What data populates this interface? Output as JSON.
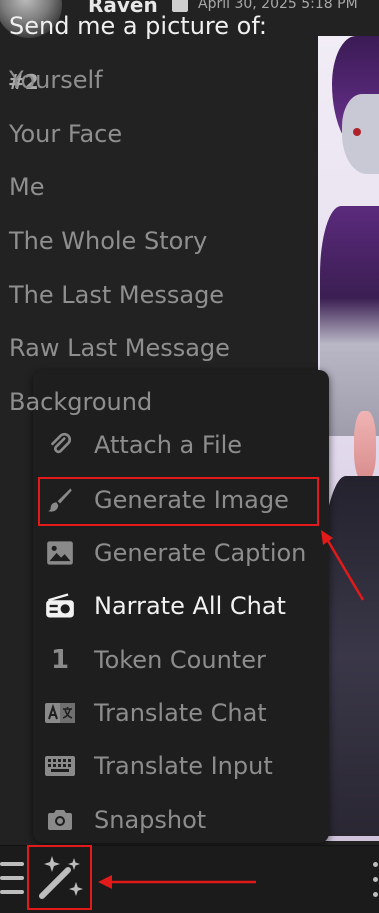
{
  "message": {
    "index": "#2",
    "author": "Raven",
    "timestamp": "April 30, 2025 5:18 PM"
  },
  "picture_menu": {
    "title": "Send me a picture of:",
    "items": [
      "Yourself",
      "Your Face",
      "Me",
      "The Whole Story",
      "The Last Message",
      "Raw Last Message",
      "Background"
    ]
  },
  "extensions_menu": {
    "items": [
      {
        "label": "Attach a File",
        "icon": "paperclip-icon"
      },
      {
        "label": "Generate Image",
        "icon": "paintbrush-icon"
      },
      {
        "label": "Generate Caption",
        "icon": "image-icon"
      },
      {
        "label": "Narrate All Chat",
        "icon": "radio-icon"
      },
      {
        "label": "Token Counter",
        "icon": "number-one-icon"
      },
      {
        "label": "Translate Chat",
        "icon": "language-icon"
      },
      {
        "label": "Translate Input",
        "icon": "keyboard-icon"
      },
      {
        "label": "Snapshot",
        "icon": "camera-icon"
      }
    ]
  },
  "token_icon_glyph": "1",
  "colors": {
    "annotation_red": "#e21a1a",
    "menu_bg": "#1e1e1e",
    "text_dim": "#8d8d8d",
    "text_bright": "#f2f2f2"
  }
}
